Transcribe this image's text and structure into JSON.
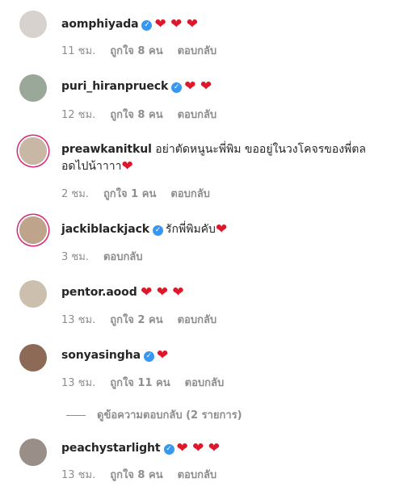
{
  "colors": {
    "heart": "#e0162b",
    "verified": "#3897f0",
    "meta": "#8e8e8e",
    "story_ring": "#d62976"
  },
  "comments": [
    {
      "username": "aomphiyada",
      "verified": true,
      "text": "",
      "hearts": "❤ ❤ ❤",
      "time": "11 ชม.",
      "likes": "ถูกใจ 8 คน",
      "reply": "ตอบกลับ",
      "avatar_color": "#d8d2cf"
    },
    {
      "username": "puri_hiranprueck",
      "verified": true,
      "text": "",
      "hearts": "❤ ❤",
      "time": "12 ชม.",
      "likes": "ถูกใจ 8 คน",
      "reply": "ตอบกลับ",
      "avatar_color": "#9aa89a"
    },
    {
      "username": "preawkanitkul",
      "verified": false,
      "text_line1": "อย่าตัดหนูนะพี่พิม ขออยู่ในวงโคจรของพี่ตล",
      "text_line2": "อดไปน้าาาา",
      "hearts": "❤",
      "time": "2 ชม.",
      "likes": "ถูกใจ 1 คน",
      "reply": "ตอบกลับ",
      "avatar_color": "#c9b7a6"
    },
    {
      "username": "jackiblackjack",
      "verified": true,
      "text": "รักพี่พิมคับ",
      "hearts": "❤",
      "time": "3 ชม.",
      "likes": "",
      "reply": "ตอบกลับ",
      "avatar_color": "#bfa48c"
    },
    {
      "username": "pentor.aood",
      "verified": false,
      "text": "",
      "hearts": "❤ ❤ ❤",
      "time": "13 ชม.",
      "likes": "ถูกใจ 2 คน",
      "reply": "ตอบกลับ",
      "avatar_color": "#cdbfae"
    },
    {
      "username": "sonyasingha",
      "verified": true,
      "text": "",
      "hearts": "❤",
      "time": "13 ชม.",
      "likes": "ถูกใจ 11 คน",
      "reply": "ตอบกลับ",
      "avatar_color": "#8c6a55"
    },
    {
      "username": "peachystarlight",
      "verified": true,
      "text": "",
      "hearts": "❤ ❤ ❤",
      "time": "13 ชม.",
      "likes": "ถูกใจ 8 คน",
      "reply": "ตอบกลับ",
      "avatar_color": "#9a8f88"
    }
  ],
  "view_replies": "ดูข้อความตอบกลับ (2 รายการ)"
}
